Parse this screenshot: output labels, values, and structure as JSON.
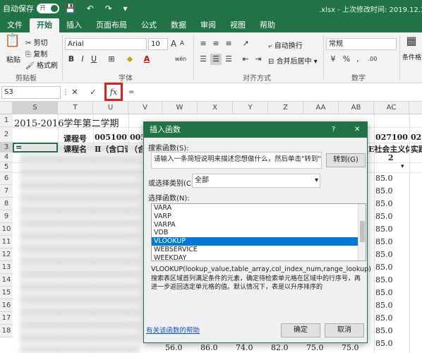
{
  "titlebar": {
    "autosave": "自动保存",
    "toggle": "开",
    "undo": "↶ ↷",
    "file_title": ".xlsx - 上次修改时间: 2019.12.30",
    "quick_icons": "💾 ↶ ↷ ▾"
  },
  "tabs": [
    "文件",
    "开始",
    "插入",
    "页面布局",
    "公式",
    "数据",
    "审阅",
    "视图",
    "帮助"
  ],
  "ribbon": {
    "clipboard": {
      "paste": "粘贴",
      "cut": "剪切",
      "copy": "复制",
      "format_painter": "格式刷",
      "label": "剪贴板"
    },
    "font": {
      "name": "Arial",
      "size": "10",
      "grow": "A",
      "shrink": "A",
      "bold": "B",
      "italic": "I",
      "underline": "U",
      "label": "字体",
      "wen": "wén"
    },
    "align": {
      "wrap": "自动换行",
      "merge": "合并后居中",
      "label": "对齐方式"
    },
    "number": {
      "format": "常规",
      "percent": "%",
      "comma": ",",
      "label": "数字",
      "dec": ".00"
    },
    "styles": {
      "cond": "条件格式"
    }
  },
  "formula": {
    "namebox": "S3",
    "cancel": "✕",
    "confirm": "✓",
    "fx": "fx",
    "content": "="
  },
  "grid": {
    "cols": [
      "S",
      "T",
      "U",
      "V",
      "W",
      "X",
      "Y",
      "Z",
      "AA",
      "AB",
      "AC"
    ],
    "rows": [
      "1",
      "2",
      "3",
      "4",
      "5",
      "6",
      "7",
      "8",
      "9",
      "10",
      "11",
      "12",
      "13",
      "14",
      "15",
      "16",
      "17",
      "18"
    ],
    "title": "2015-2016学年第二学期",
    "r2_label": "课程号",
    "r2_code1": "0051002",
    "r2_code2": "0051",
    "r2_code3": "0271003",
    "r2_code4": "0271",
    "r3_eq": "=",
    "r3_label": "课程名",
    "r3_c1": "Ⅱ（含口语",
    "r3_c2": "（合同",
    "r3_c3": "E社会主义体",
    "r3_c4": "实践",
    "r4_val": "2",
    "scores": [
      "85.0",
      "85.0",
      "85.0",
      "85.0",
      "85.0",
      "85.0",
      "85.0",
      "85.0",
      "85.0",
      "85.0",
      "85.0",
      "85.0",
      "85.0",
      "85.0"
    ],
    "bottom_vals": [
      "56.0",
      "86.0",
      "74.0",
      "82.0",
      "75.0",
      "75.0",
      "85.0"
    ]
  },
  "dialog": {
    "title": "插入函数",
    "help": "?",
    "close": "✕",
    "search_label": "搜索函数(S):",
    "search_text": "请输入一条简短说明来描述您想做什么，然后单击\"转到\"",
    "go_button": "转到(G)",
    "category_label": "或选择类别(C):",
    "category_value": "全部",
    "function_label": "选择函数(N):",
    "functions": [
      "VARA",
      "VARP",
      "VARPA",
      "VDB",
      "VLOOKUP",
      "WEBSERVICE",
      "WEEKDAY"
    ],
    "selected": "VLOOKUP",
    "signature": "VLOOKUP(lookup_value,table_array,col_index_num,range_lookup)",
    "description": "搜索表区域首列满足条件的元素，确定待检索单元格在区域中的行序号，再进一步返回选定单元格的值。默认情况下，表是以升序排序的",
    "help_link": "有关该函数的帮助",
    "ok": "确定",
    "cancel": "取消"
  }
}
